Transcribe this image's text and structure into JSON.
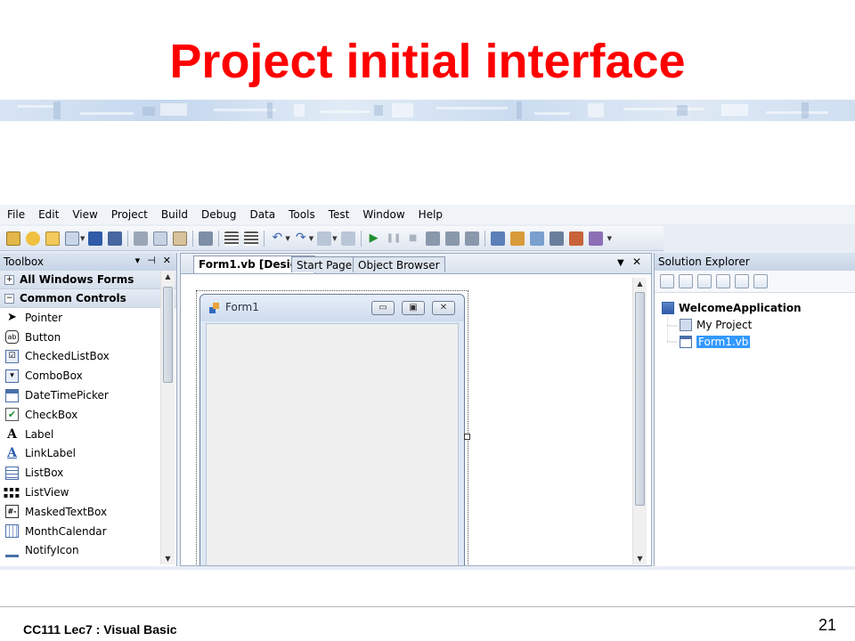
{
  "slide": {
    "title": "Project initial interface",
    "footer": "CC111 Lec7 :  Visual Basic",
    "page_number": "21"
  },
  "colors": {
    "title": "#ff0000",
    "selection": "#3399ff",
    "panel_header": "#c7d4e6"
  },
  "ide": {
    "menu": [
      "File",
      "Edit",
      "View",
      "Project",
      "Build",
      "Debug",
      "Data",
      "Tools",
      "Test",
      "Window",
      "Help"
    ],
    "toolbox": {
      "title": "Toolbox",
      "groups": [
        "All Windows Forms",
        "Common Controls"
      ],
      "items": [
        {
          "label": "Pointer",
          "icon": "pointer-icon"
        },
        {
          "label": "Button",
          "icon": "button-icon"
        },
        {
          "label": "CheckedListBox",
          "icon": "checkedlistbox-icon"
        },
        {
          "label": "ComboBox",
          "icon": "combobox-icon"
        },
        {
          "label": "DateTimePicker",
          "icon": "datetimepicker-icon"
        },
        {
          "label": "CheckBox",
          "icon": "checkbox-icon"
        },
        {
          "label": "Label",
          "icon": "label-icon"
        },
        {
          "label": "LinkLabel",
          "icon": "linklabel-icon"
        },
        {
          "label": "ListBox",
          "icon": "listbox-icon"
        },
        {
          "label": "ListView",
          "icon": "listview-icon"
        },
        {
          "label": "MaskedTextBox",
          "icon": "maskedtextbox-icon"
        },
        {
          "label": "MonthCalendar",
          "icon": "monthcalendar-icon"
        },
        {
          "label": "NotifyIcon",
          "icon": "notifyicon-icon"
        }
      ]
    },
    "tabs": [
      "Form1.vb [Design]",
      "Start Page",
      "Object Browser"
    ],
    "form": {
      "title": "Form1"
    },
    "solution_explorer": {
      "title": "Solution Explorer",
      "root": "WelcomeApplication",
      "children": [
        "My Project",
        "Form1.vb"
      ]
    }
  }
}
